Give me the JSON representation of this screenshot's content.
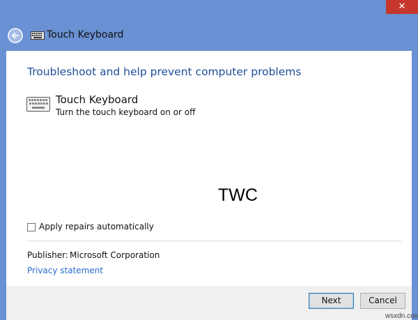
{
  "window": {
    "close_glyph": "✕",
    "title": "Touch Keyboard"
  },
  "icons": {
    "back": "back-arrow-icon",
    "keyboard": "keyboard-icon",
    "close": "close-icon"
  },
  "content": {
    "heading": "Troubleshoot and help prevent computer problems",
    "item_title": "Touch Keyboard",
    "item_desc": "Turn the touch keyboard on or off",
    "checkbox_label": "Apply repairs automatically",
    "checkbox_checked": false,
    "publisher_label": "Publisher:",
    "publisher_value": "Microsoft Corporation",
    "privacy_link": "Privacy statement"
  },
  "footer": {
    "next_label": "Next",
    "cancel_label": "Cancel"
  },
  "overlay": {
    "twc": "TWC",
    "site": "wsxdn.com"
  },
  "colors": {
    "frame": "#6a91d3",
    "close": "#c6362c",
    "heading": "#1e4d9a",
    "link": "#2a6bcf"
  }
}
